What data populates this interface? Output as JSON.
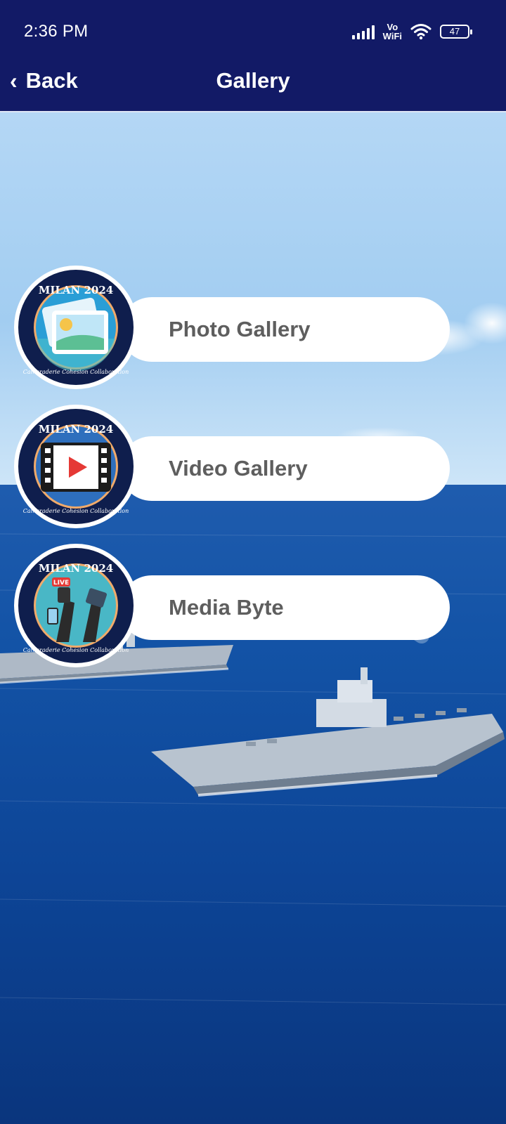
{
  "status_bar": {
    "time": "2:36 PM",
    "network_label_top": "Vo",
    "network_label_bottom": "WiFi",
    "battery_level": "47"
  },
  "nav": {
    "back_label": "Back",
    "title": "Gallery"
  },
  "menu": {
    "items": [
      {
        "label": "Photo Gallery",
        "icon": "photo-icon"
      },
      {
        "label": "Video Gallery",
        "icon": "video-play-icon"
      },
      {
        "label": "Media Byte",
        "icon": "live-microphone-icon"
      }
    ]
  },
  "badge": {
    "top_text": "MILAN 2024",
    "bottom_text": "Camaraderie Cohesion Collaboration"
  },
  "colors": {
    "header": "#121a66",
    "pill": "#ffffff",
    "label": "#5e5e5e",
    "badge_ring": "#0f1e4d",
    "sea": "#0d3f8f"
  }
}
